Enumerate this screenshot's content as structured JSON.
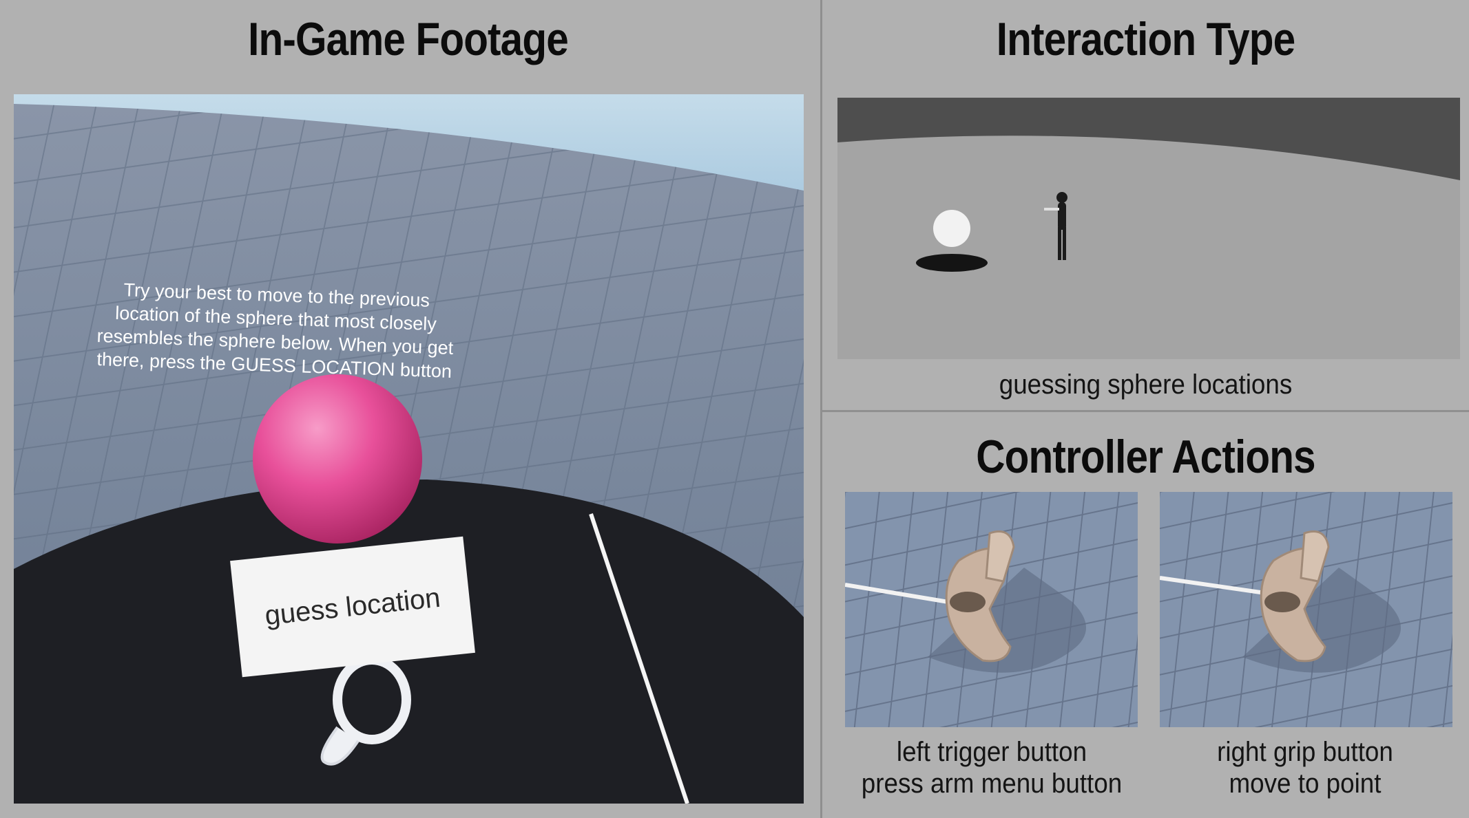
{
  "left": {
    "title": "In-Game Footage",
    "scene": {
      "instruction_lines": [
        "Try your best to move to the previous",
        "location of the sphere that most closely",
        "resembles the sphere below. When you get",
        "there, press the GUESS LOCATION button"
      ],
      "button_label": "guess location",
      "sphere_color": "#e8509a"
    }
  },
  "right_top": {
    "title": "Interaction Type",
    "caption": "guessing sphere locations"
  },
  "right_bottom": {
    "title": "Controller Actions",
    "items": [
      {
        "line1": "left trigger button",
        "line2": "press arm menu button"
      },
      {
        "line1": "right grip button",
        "line2": "move to point"
      }
    ]
  }
}
